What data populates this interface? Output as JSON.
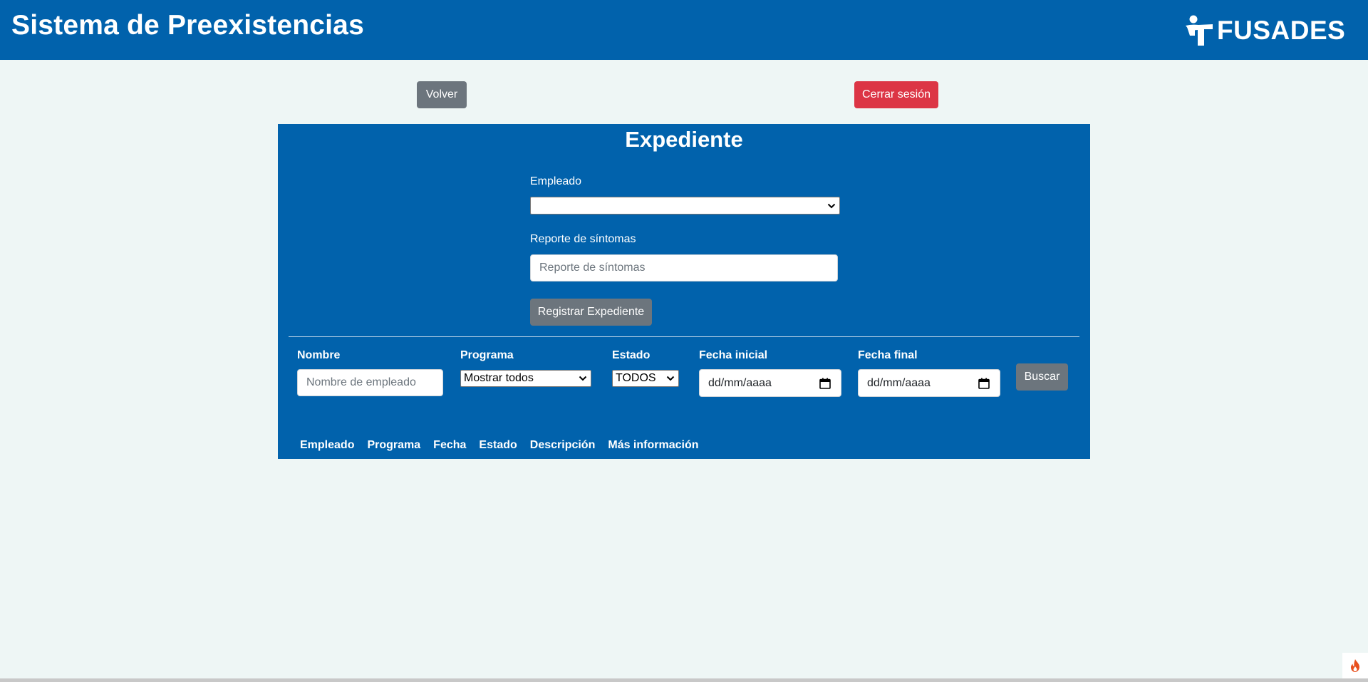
{
  "header": {
    "title": "Sistema de Preexistencias",
    "logo_text": "FUSADES"
  },
  "nav": {
    "back_label": "Volver",
    "logout_label": "Cerrar sesión"
  },
  "form": {
    "title": "Expediente",
    "empleado_label": "Empleado",
    "empleado_value": "",
    "reporte_label": "Reporte de síntomas",
    "reporte_placeholder": "Reporte de síntomas",
    "submit_label": "Registrar Expediente"
  },
  "filters": {
    "nombre_label": "Nombre",
    "nombre_placeholder": "Nombre de empleado",
    "programa_label": "Programa",
    "programa_value": "Mostrar todos",
    "estado_label": "Estado",
    "estado_value": "TODOS",
    "fecha_inicial_label": "Fecha inicial",
    "fecha_inicial_value": "dd/mm/aaaa",
    "fecha_final_label": "Fecha final",
    "fecha_final_value": "dd/mm/aaaa",
    "search_label": "Buscar"
  },
  "table": {
    "columns": [
      "Empleado",
      "Programa",
      "Fecha",
      "Estado",
      "Descripción",
      "Más información"
    ]
  },
  "colors": {
    "brand_blue": "#0162ac",
    "page_bg": "#eef6f5",
    "secondary_button": "#6c757d",
    "danger_button": "#dc3545"
  },
  "icons": {
    "logo": "fusades-logo-icon",
    "select_arrow": "chevron-down-icon",
    "date_picker": "calendar-icon",
    "corner": "flame-icon"
  }
}
